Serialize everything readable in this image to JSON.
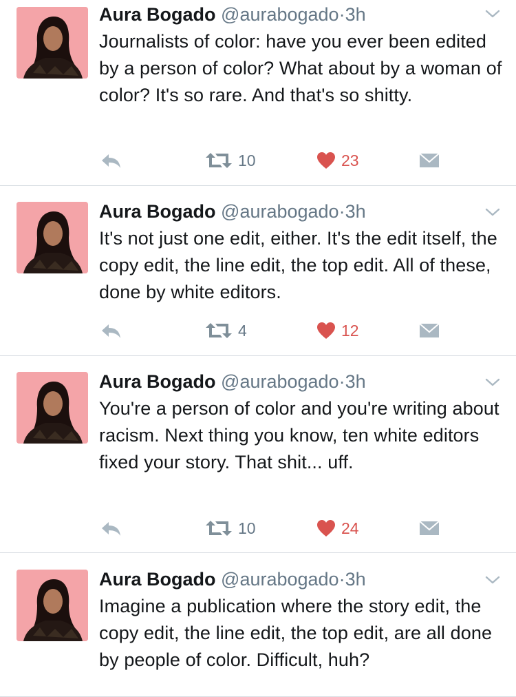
{
  "colors": {
    "name": "#14171a",
    "meta": "#657786",
    "like": "#d9534f",
    "avatar_bg": "#f4a4a8",
    "divider": "#d8dde2"
  },
  "tweets": [
    {
      "name": "Aura Bogado",
      "handle": "@aurabogado",
      "separator": "·",
      "time": "3h",
      "text": "Journalists of color: have you ever been edited by a person of color? What about by a woman of color? It's so rare. And that's so shitty.",
      "retweets": "10",
      "likes": "23"
    },
    {
      "name": "Aura Bogado",
      "handle": "@aurabogado",
      "separator": "·",
      "time": "3h",
      "text": "It's not just one edit, either. It's the edit itself, the copy edit, the line edit, the top edit. All of these, done by white editors.",
      "retweets": "4",
      "likes": "12"
    },
    {
      "name": "Aura Bogado",
      "handle": "@aurabogado",
      "separator": "·",
      "time": "3h",
      "text": "You're a person of color and you're writing about racism. Next thing you know, ten white editors fixed your story. That shit... uff.",
      "retweets": "10",
      "likes": "24"
    },
    {
      "name": "Aura Bogado",
      "handle": "@aurabogado",
      "separator": "·",
      "time": "3h",
      "text": "Imagine a publication where the story edit, the copy edit, the line edit, the top edit, are all done by people of color. Difficult, huh?"
    }
  ]
}
